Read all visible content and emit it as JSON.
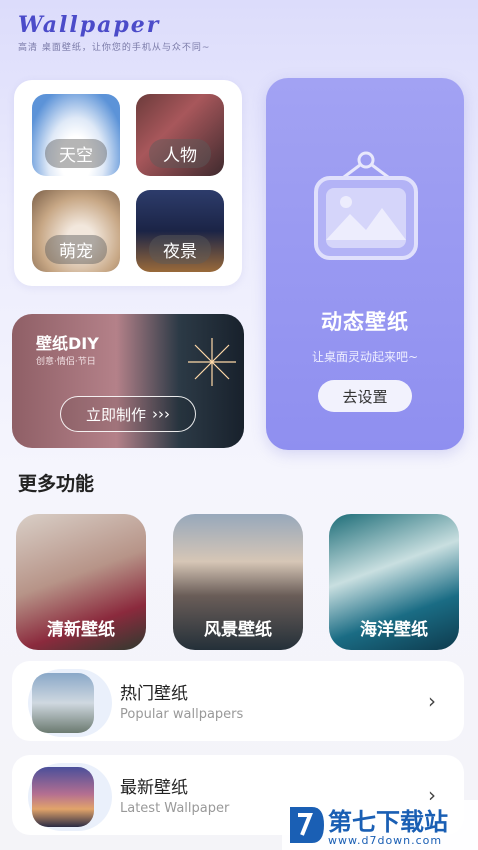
{
  "header": {
    "logo": "Wallpaper",
    "tagline": "高清 桌面壁纸，让你您的手机从与众不同~"
  },
  "categories": [
    {
      "label": "天空"
    },
    {
      "label": "人物"
    },
    {
      "label": "萌宠"
    },
    {
      "label": "夜景"
    }
  ],
  "dynamic": {
    "title": "动态壁纸",
    "subtitle": "让桌面灵动起来吧~",
    "button": "去设置"
  },
  "diy": {
    "title": "壁纸DIY",
    "subtitle": "创意·情侣·节日",
    "button": "立即制作",
    "button_arrows": "›››"
  },
  "more": {
    "title": "更多功能",
    "features": [
      {
        "label": "清新壁纸"
      },
      {
        "label": "风景壁纸"
      },
      {
        "label": "海洋壁纸"
      }
    ]
  },
  "list": [
    {
      "title": "热门壁纸",
      "subtitle": "Popular wallpapers",
      "chevron": "›"
    },
    {
      "title": "最新壁纸",
      "subtitle": "Latest Wallpaper",
      "chevron": "›"
    }
  ],
  "watermark": {
    "text": "第七下载站",
    "url": "www.d7down.com"
  },
  "colors": {
    "accent": "#8f8ff0",
    "logo": "#4b4bc9"
  }
}
